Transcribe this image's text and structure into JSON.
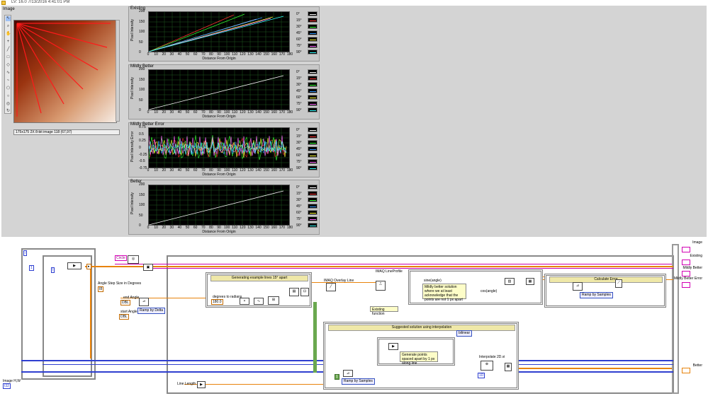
{
  "window": {
    "title": "LV: 16.0 7/13/2016 4:41:01 PM"
  },
  "front_panel": {
    "image_label": "Image",
    "image_info": "175x175 2X 8-bit image 118     (67,97)",
    "tools": [
      "pointer",
      "zoom",
      "pan",
      "point",
      "line",
      "rect",
      "oval",
      "poly",
      "freehand",
      "broken",
      "annulus",
      "rotate"
    ],
    "charts": [
      {
        "label": "Existing",
        "ylabel": "Pixel Intensity",
        "xlabel": "Distance From Origin",
        "yticks": [
          "0",
          "50",
          "100",
          "150",
          "200"
        ],
        "xticks": [
          "0",
          "10",
          "20",
          "30",
          "40",
          "50",
          "60",
          "70",
          "80",
          "90",
          "100",
          "110",
          "120",
          "130",
          "140",
          "150",
          "160",
          "170",
          "180"
        ],
        "legend": [
          "0°",
          "15°",
          "30°",
          "45°",
          "60°",
          "75°",
          "90°"
        ]
      },
      {
        "label": "Mildly Better",
        "ylabel": "Pixel Intensity",
        "xlabel": "Distance From Origin",
        "yticks": [
          "0",
          "50",
          "100",
          "150",
          "200"
        ],
        "xticks": [
          "0",
          "10",
          "20",
          "30",
          "40",
          "50",
          "60",
          "70",
          "80",
          "90",
          "100",
          "110",
          "120",
          "130",
          "140",
          "150",
          "160",
          "170",
          "180"
        ],
        "legend": [
          "0°",
          "15°",
          "30°",
          "45°",
          "60°",
          "75°",
          "90°"
        ]
      },
      {
        "label": "Mildly Better Error",
        "ylabel": "Pixel Intensity Error",
        "xlabel": "Distance From Origin",
        "yticks": [
          "-0.75",
          "-0.5",
          "-0.25",
          "0",
          "0.25",
          "0.5",
          "0.75"
        ],
        "xticks": [
          "0",
          "10",
          "20",
          "30",
          "40",
          "50",
          "60",
          "70",
          "80",
          "90",
          "100",
          "110",
          "120",
          "130",
          "140",
          "150",
          "160",
          "170",
          "180"
        ],
        "legend": [
          "0°",
          "15°",
          "30°",
          "45°",
          "60°",
          "75°",
          "90°"
        ]
      },
      {
        "label": "Better",
        "ylabel": "Pixel Intensity",
        "xlabel": "Distance From Origin",
        "yticks": [
          "0",
          "50",
          "100",
          "150",
          "200"
        ],
        "xticks": [
          "0",
          "10",
          "20",
          "30",
          "40",
          "50",
          "60",
          "70",
          "80",
          "90",
          "100",
          "110",
          "120",
          "130",
          "140",
          "150",
          "160",
          "170",
          "180"
        ],
        "legend": [
          "0°",
          "15°",
          "30°",
          "45°",
          "60°",
          "75°",
          "90°"
        ]
      }
    ],
    "legend_colors": [
      "#ffffff",
      "#ff3030",
      "#33ff33",
      "#3399ff",
      "#ffff33",
      "#ff66ff",
      "#33ffff"
    ]
  },
  "block_diagram": {
    "circle_const": "Circle",
    "angle_step_label": "Angle Step Size in Degrees",
    "end_angle_label": "end Angle",
    "start_angle_label": "start Angle",
    "ramp_delta": "Ramp by Delta",
    "ramp_samples_1": "Ramp by Samples",
    "ramp_samples_2": "Ramp by Samples",
    "seq1_title": "Generating example lines 15° apart",
    "deg_to_rad_label": "degrees to radians",
    "deg_const": "180.0",
    "overlay_label": "IMAQ Overlay Line",
    "lineprofile_label": "IMAQ LineProfile",
    "existing_fn_label": "Existing function",
    "sine_label": "sine(angle)",
    "cos_label": "cos(angle)",
    "mildly_comment": "Mildly better solution where we at least acknowledge that the points are not 1 px apart",
    "calc_error_title": "Calculate Error",
    "suggested_title": "Suggested solution using interpolation",
    "bilinear": "bilinear",
    "gen_points_comment": "Generate points spaced apart by 1 px along line",
    "interp_label": "Interpolate 2D.vi",
    "line_length_label": "Line Length",
    "image_hw_label": "Image H,W",
    "indicators": {
      "image": "Image",
      "existing": "Existing",
      "mildly_better": "Mildly Better",
      "mildly_better_error": "Mildly Better Error",
      "better": "Better"
    },
    "const_1": "1",
    "const_0": "0"
  }
}
